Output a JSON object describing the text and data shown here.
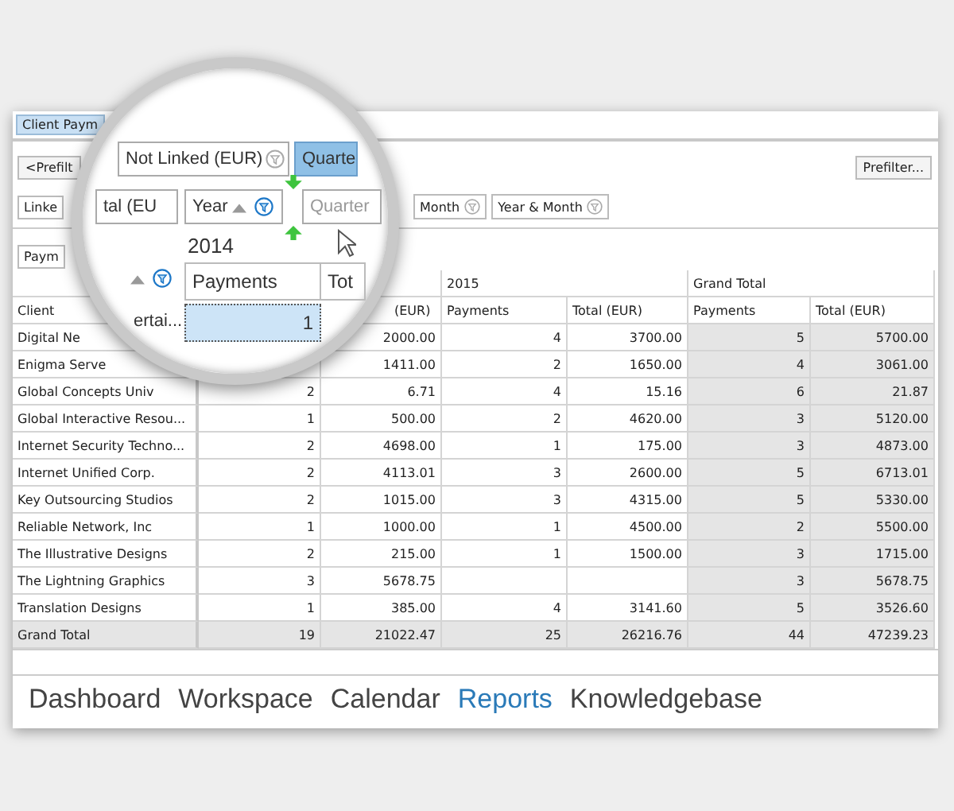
{
  "panel_tab": "Client Paym",
  "prefilter_left": "<Prefilt",
  "prefilter_button": "Prefilter...",
  "left_chip": {
    "label": "Linke"
  },
  "right_chips": [
    {
      "label": "Month"
    },
    {
      "label": "Year & Month"
    }
  ],
  "data_chip": {
    "label": "Paym"
  },
  "lens": {
    "not_linked": "Not Linked (EUR)",
    "quarter_top": "Quarte",
    "total_chip": "tal (EU",
    "year_chip": "Year",
    "quarter_chip": "Quarter",
    "year_label": "2014",
    "payments_header": "Payments",
    "total_header": "Tot",
    "client_cut": "ertai...",
    "selected_value": "1"
  },
  "table": {
    "column_groups": [
      "2015",
      "Grand Total"
    ],
    "header": {
      "client": "Client",
      "column_3": "(EUR)",
      "rest": [
        "Payments",
        "Total (EUR)",
        "Payments",
        "Total (EUR)"
      ]
    },
    "rows": [
      {
        "client": "Digital Ne",
        "cells": [
          null,
          "2000.00",
          "4",
          "3700.00",
          "5",
          "5700.00"
        ]
      },
      {
        "client": "Enigma Serve",
        "cells": [
          null,
          "1411.00",
          "2",
          "1650.00",
          "4",
          "3061.00"
        ]
      },
      {
        "client": "Global Concepts Univ",
        "cells": [
          "2",
          "6.71",
          "4",
          "15.16",
          "6",
          "21.87"
        ]
      },
      {
        "client": "Global Interactive Resou...",
        "cells": [
          "1",
          "500.00",
          "2",
          "4620.00",
          "3",
          "5120.00"
        ]
      },
      {
        "client": "Internet Security Techno...",
        "cells": [
          "2",
          "4698.00",
          "1",
          "175.00",
          "3",
          "4873.00"
        ]
      },
      {
        "client": "Internet Unified Corp.",
        "cells": [
          "2",
          "4113.01",
          "3",
          "2600.00",
          "5",
          "6713.01"
        ]
      },
      {
        "client": "Key Outsourcing Studios",
        "cells": [
          "2",
          "1015.00",
          "3",
          "4315.00",
          "5",
          "5330.00"
        ]
      },
      {
        "client": "Reliable Network, Inc",
        "cells": [
          "1",
          "1000.00",
          "1",
          "4500.00",
          "2",
          "5500.00"
        ]
      },
      {
        "client": "The Illustrative Designs",
        "cells": [
          "2",
          "215.00",
          "1",
          "1500.00",
          "3",
          "1715.00"
        ]
      },
      {
        "client": "The Lightning Graphics",
        "cells": [
          "3",
          "5678.75",
          null,
          null,
          "3",
          "5678.75"
        ]
      },
      {
        "client": "Translation Designs",
        "cells": [
          "1",
          "385.00",
          "4",
          "3141.60",
          "5",
          "3526.60"
        ]
      }
    ],
    "grand_total": {
      "label": "Grand Total",
      "cells": [
        "19",
        "21022.47",
        "25",
        "26216.76",
        "44",
        "47239.23"
      ]
    }
  },
  "nav": [
    {
      "label": "Dashboard",
      "selected": false
    },
    {
      "label": "Workspace",
      "selected": false
    },
    {
      "label": "Calendar",
      "selected": false
    },
    {
      "label": "Reports",
      "selected": true
    },
    {
      "label": "Knowledgebase",
      "selected": false
    }
  ]
}
